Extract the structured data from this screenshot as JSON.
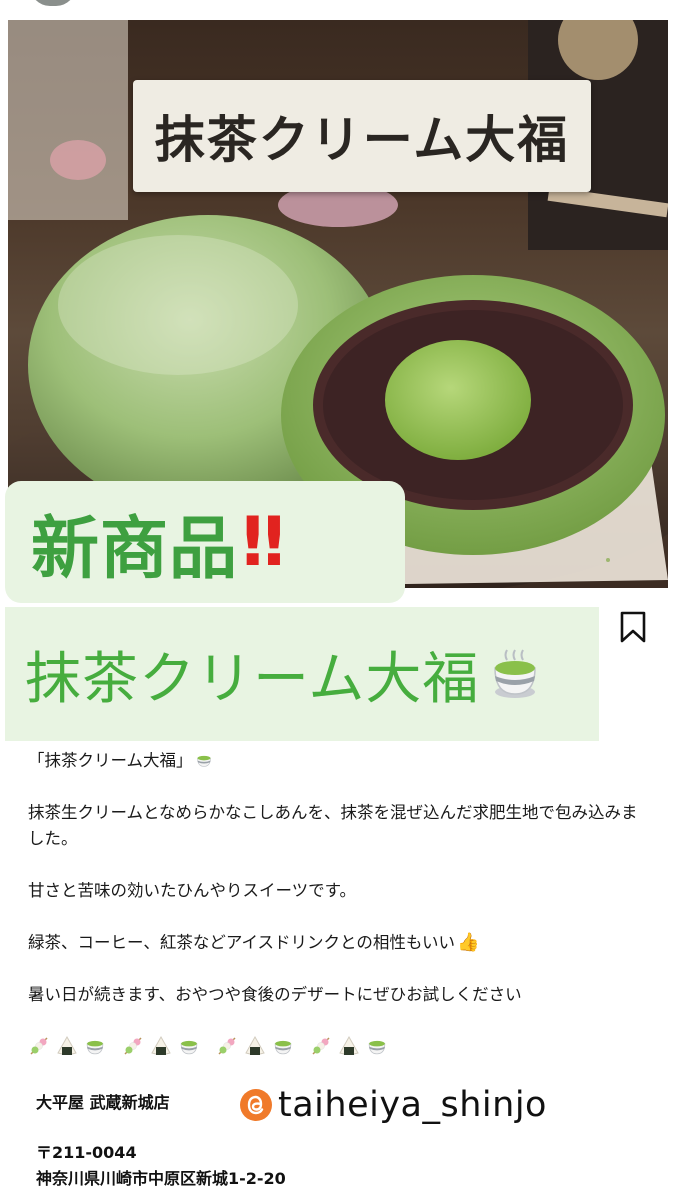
{
  "image": {
    "banner_title": "抹茶クリーム大福"
  },
  "badge": {
    "text": "新商品",
    "exclamation": "‼",
    "accent_color": "#3ea040",
    "exclaim_color": "#e1231f"
  },
  "product_name": {
    "text": "抹茶クリーム大福",
    "icon": "green-tea-icon",
    "color": "#46ad3e"
  },
  "actions": {
    "bookmark_icon": "bookmark-icon"
  },
  "caption": {
    "title": "「抹茶クリーム大福」",
    "line1": "抹茶生クリームとなめらかなこしあんを、抹茶を混ぜ込んだ求肥生地で包み込みました。",
    "line2": "甘さと苦味の効いたひんやりスイーツです。",
    "line3": "緑茶、コーヒー、紅茶などアイスドリンクとの相性もいい",
    "line4": "暑い日が続きます、おやつや食後のデザートにぜひお試しください",
    "thumb_icon": "thumbs-up-icon"
  },
  "emoji_row": [
    "dango-icon",
    "onigiri-icon",
    "green-tea-icon",
    "dango-icon",
    "onigiri-icon",
    "green-tea-icon",
    "dango-icon",
    "onigiri-icon",
    "green-tea-icon",
    "dango-icon",
    "onigiri-icon",
    "green-tea-icon"
  ],
  "shop": {
    "name": "大平屋 武蔵新城店",
    "threads_handle": "taiheiya_shinjo",
    "postal": "〒211-0044",
    "address": "神奈川県川崎市中原区新城1-2-20"
  }
}
